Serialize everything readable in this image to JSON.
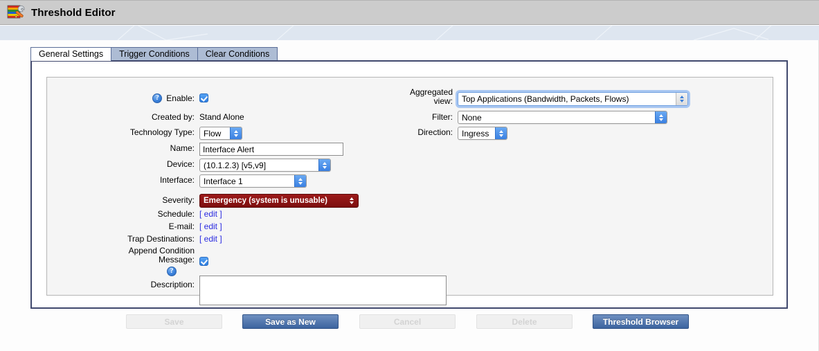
{
  "window": {
    "title": "Threshold Editor",
    "icon": "threshold-editor-icon"
  },
  "tabs": [
    {
      "label": "General Settings",
      "active": true
    },
    {
      "label": "Trigger Conditions",
      "active": false
    },
    {
      "label": "Clear Conditions",
      "active": false
    }
  ],
  "form": {
    "enable": {
      "label": "Enable:",
      "help_icon": "help-icon",
      "checked": true
    },
    "created_by": {
      "label": "Created by:",
      "value": "Stand Alone"
    },
    "technology_type": {
      "label": "Technology Type:",
      "value": "Flow"
    },
    "name": {
      "label": "Name:",
      "value": "Interface Alert",
      "placeholder": ""
    },
    "device": {
      "label": "Device:",
      "value": "(10.1.2.3) [v5,v9]"
    },
    "interface": {
      "label": "Interface:",
      "value": "Interface 1"
    },
    "severity": {
      "label": "Severity:",
      "value": "Emergency (system is unusable)",
      "color": "#8b1414"
    },
    "schedule": {
      "label": "Schedule:",
      "link": "[ edit ]"
    },
    "email": {
      "label": "E-mail:",
      "link": "[ edit ]"
    },
    "trap_destinations": {
      "label": "Trap Destinations:",
      "link": "[ edit ]"
    },
    "append_condition_message": {
      "label_line1": "Append Condition",
      "label_line2": "Message:",
      "help_icon": "help-icon",
      "checked": true
    },
    "description": {
      "label": "Description:",
      "value": "",
      "placeholder": ""
    },
    "aggregated_view": {
      "label_line1": "Aggregated",
      "label_line2": "view:",
      "value": "Top Applications (Bandwidth, Packets, Flows)",
      "focused": true
    },
    "filter": {
      "label": "Filter:",
      "value": "None"
    },
    "direction": {
      "label": "Direction:",
      "value": "Ingress"
    }
  },
  "buttons": [
    {
      "label": "Save",
      "state": "disabled"
    },
    {
      "label": "Save as New",
      "state": "primary"
    },
    {
      "label": "Cancel",
      "state": "disabled"
    },
    {
      "label": "Delete",
      "state": "disabled"
    },
    {
      "label": "Threshold Browser",
      "state": "primary"
    }
  ]
}
